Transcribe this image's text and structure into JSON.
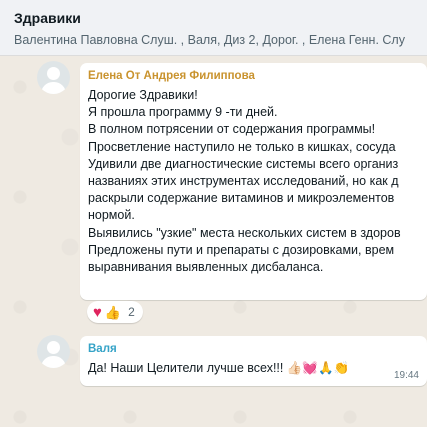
{
  "header": {
    "title": "Здравики",
    "members": "Валентина Павловна Слуш. , Валя, Диз 2, Дорог. , Елена Генн. Слу"
  },
  "messages": [
    {
      "sender": "Елена От Андрея Филиппова",
      "sender_color": "#c9932e",
      "lines": [
        "Дорогие Здравики!",
        "Я прошла программу 9 -ти дней.",
        "В полном потрясении от содержания программы!",
        "Просветление наступило не только в кишках, сосуда",
        "Удивили две диагностические системы всего организ",
        "названиях этих инструментах исследований, но как д",
        "раскрыли содержание витаминов и микроэлементов",
        "нормой.",
        "Выявились \"узкие\" места нескольких систем в здоров",
        "Предложены пути и препараты с дозировками, врем",
        "выравнивания выявленных дисбаланса."
      ],
      "reactions": {
        "emojis": [
          "heart",
          "thumbs-up"
        ],
        "count": "2"
      }
    },
    {
      "sender": "Валя",
      "sender_color": "#35a3c7",
      "text": "Да! Наши Целители лучше всех!!! 👍🏻💓🙏👏",
      "time": "19:44"
    }
  ]
}
